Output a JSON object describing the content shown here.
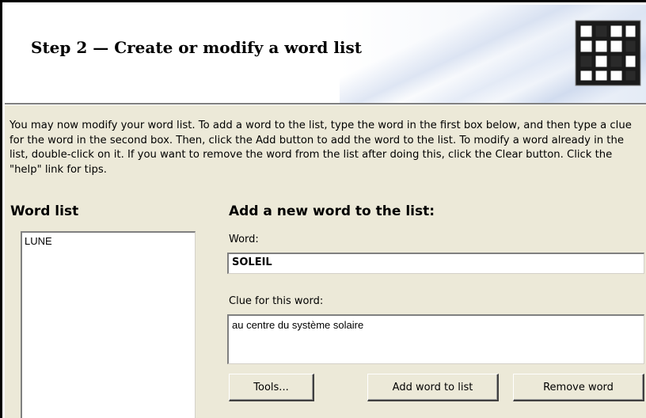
{
  "header": {
    "title": "Step 2 — Create or modify a word list"
  },
  "intro_text": "You may now modify your word list.  To add a word to the list, type the word in the first box below, and then type a clue for the word in the second box.  Then, click the Add button to add the word to the list.  To modify a word already in the list, double-click on it.  If you want to remove the word from the list after doing this, click the Clear button.  Click the \"help\" link for tips.",
  "word_list": {
    "heading": "Word list",
    "items": [
      "LUNE"
    ]
  },
  "add_word": {
    "heading": "Add a new word to the list:",
    "word_label": "Word:",
    "word_value": "SOLEIL",
    "clue_label": "Clue for this word:",
    "clue_value": "au centre du système solaire"
  },
  "buttons": {
    "tools": "Tools...",
    "add": "Add word to list",
    "remove": "Remove word"
  },
  "colors": {
    "dialog_background": "#ece9d8",
    "header_background": "#ffffff"
  },
  "icons": {
    "header_icon": "crossword-grid-icon"
  }
}
